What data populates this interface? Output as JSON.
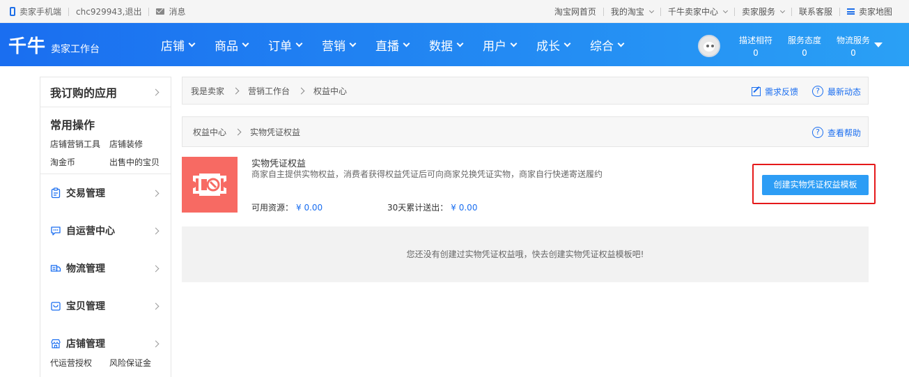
{
  "topbar": {
    "mobile_label": "卖家手机端",
    "account": "chc929943,退出",
    "messages": "消息",
    "links": [
      "淘宝网首页",
      "我的淘宝",
      "千牛卖家中心",
      "卖家服务",
      "联系客服"
    ],
    "map": "卖家地图"
  },
  "header": {
    "logo": "千牛",
    "sublogo": "卖家工作台",
    "nav": [
      "店铺",
      "商品",
      "订单",
      "营销",
      "直播",
      "数据",
      "用户",
      "成长",
      "综合"
    ],
    "stats": [
      {
        "label": "描述相符",
        "value": "0"
      },
      {
        "label": "服务态度",
        "value": "0"
      },
      {
        "label": "物流服务",
        "value": "0"
      }
    ]
  },
  "sidebar": {
    "apps_title": "我订购的应用",
    "common_title": "常用操作",
    "common_links": [
      "店铺营销工具",
      "店铺装修",
      "淘金币",
      "出售中的宝贝"
    ],
    "sections": [
      "交易管理",
      "自运营中心",
      "物流管理",
      "宝贝管理",
      "店铺管理"
    ],
    "shop_sub": [
      "代运营授权",
      "风险保证金"
    ]
  },
  "breadcrumb1": {
    "items": [
      "我是卖家",
      "营销工作台",
      "权益中心"
    ],
    "feedback": "需求反馈",
    "news": "最新动态"
  },
  "breadcrumb2": {
    "items": [
      "权益中心",
      "实物凭证权益"
    ],
    "help": "查看帮助"
  },
  "benefit": {
    "title": "实物凭证权益",
    "description": "商家自主提供实物权益，消费者获得权益凭证后可向商家兑换凭证实物，商家自行快递寄送履约",
    "available_label": "可用资源：",
    "available_value": "¥ 0.00",
    "sent_label": "30天累计送出：",
    "sent_value": "¥ 0.00",
    "create_button": "创建实物凭证权益模板"
  },
  "empty_message": "您还没有创建过实物凭证权益哦，快去创建实物凭证权益模板吧!"
}
